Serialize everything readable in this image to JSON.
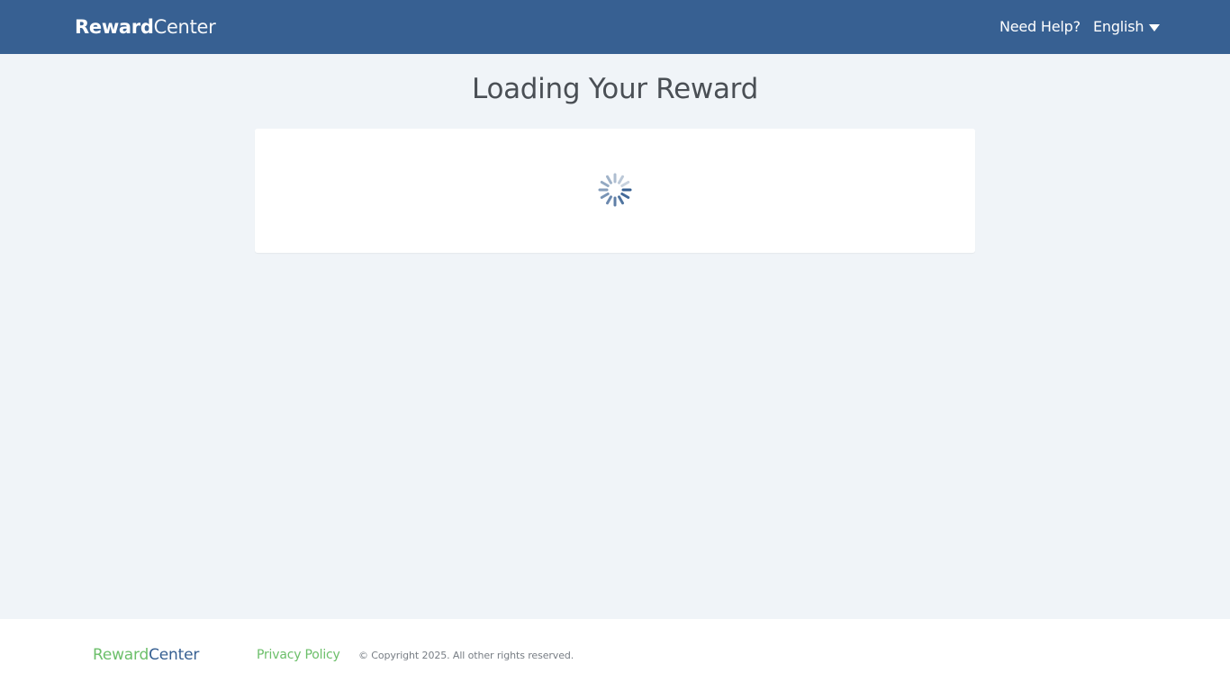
{
  "header": {
    "logo_bold": "Reward",
    "logo_light": "Center",
    "help_label": "Need Help?",
    "language_label": "English",
    "background_color": "#376092"
  },
  "main": {
    "title": "Loading Your Reward",
    "spinner_icon": "loading-spinner-icon"
  },
  "footer": {
    "logo_green": "Reward",
    "logo_blue": "Center",
    "privacy_label": "Privacy Policy",
    "copyright": "© Copyright 2025. All other rights reserved.",
    "accent_color": "#6cbf6a"
  }
}
